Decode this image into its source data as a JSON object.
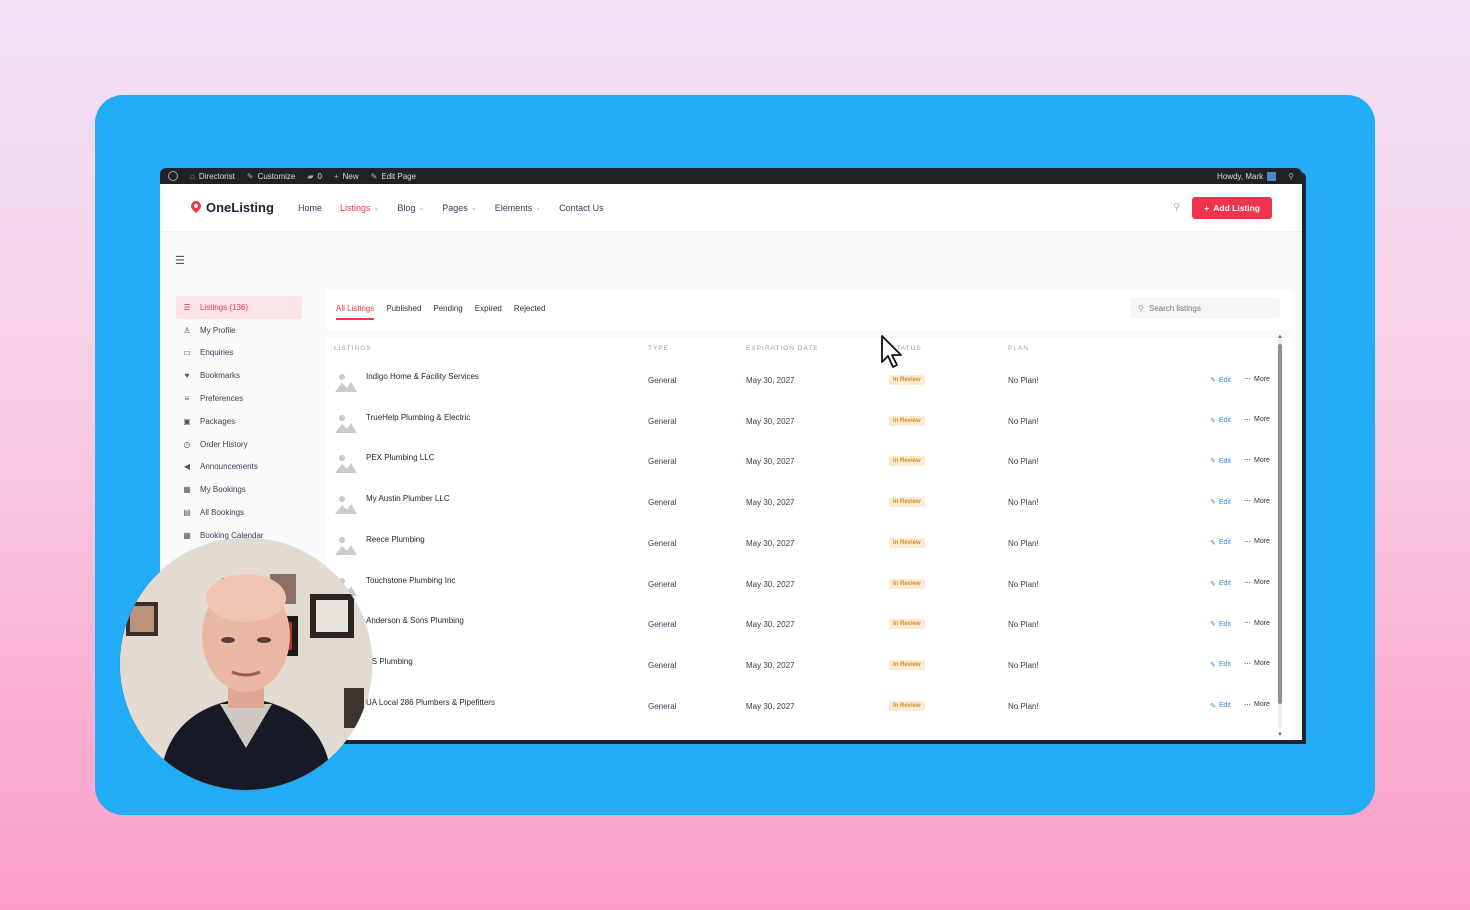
{
  "colors": {
    "accent": "#f0344c",
    "background_card": "#22adf6",
    "status_bg": "#fdecd2",
    "status_text": "#d3892b",
    "edit_link": "#3a8ed8"
  },
  "adminbar": {
    "site": "Directorist",
    "customize": "Customize",
    "comments": "0",
    "new": "New",
    "edit_page": "Edit Page",
    "howdy": "Howdy, Mark"
  },
  "header": {
    "logo": "OneListing",
    "nav": [
      "Home",
      "Listings",
      "Blog",
      "Pages",
      "Elements",
      "Contact Us"
    ],
    "add_listing": "Add Listing"
  },
  "sidebar": {
    "items": [
      {
        "label": "Listings (136)",
        "icon": "list-icon"
      },
      {
        "label": "My Profile",
        "icon": "user-icon"
      },
      {
        "label": "Enquiries",
        "icon": "inbox-icon"
      },
      {
        "label": "Bookmarks",
        "icon": "heart-icon"
      },
      {
        "label": "Preferences",
        "icon": "sliders-icon"
      },
      {
        "label": "Packages",
        "icon": "package-icon"
      },
      {
        "label": "Order History",
        "icon": "clock-icon"
      },
      {
        "label": "Announcements",
        "icon": "megaphone-icon"
      },
      {
        "label": "My Bookings",
        "icon": "calendar-icon"
      },
      {
        "label": "All Bookings",
        "icon": "table-icon"
      },
      {
        "label": "Booking Calendar",
        "icon": "calendar-icon"
      }
    ]
  },
  "tabs": [
    "All Listings",
    "Published",
    "Pending",
    "Expired",
    "Rejected"
  ],
  "search": {
    "placeholder": "Search listings"
  },
  "table": {
    "headers": [
      "LISTINGS",
      "TYPE",
      "EXPIRATION DATE",
      "STATUS",
      "PLAN"
    ],
    "edit_label": "Edit",
    "more_label": "More",
    "rows": [
      {
        "title": "Indigo Home & Facility Services",
        "type": "General",
        "expiration": "May 30, 2027",
        "status": "In Review",
        "plan": "No Plan!"
      },
      {
        "title": "TrueHelp Plumbing & Electric",
        "type": "General",
        "expiration": "May 30, 2027",
        "status": "In Review",
        "plan": "No Plan!"
      },
      {
        "title": "PEX Plumbing LLC",
        "type": "General",
        "expiration": "May 30, 2027",
        "status": "In Review",
        "plan": "No Plan!"
      },
      {
        "title": "My Austin Plumber LLC",
        "type": "General",
        "expiration": "May 30, 2027",
        "status": "In Review",
        "plan": "No Plan!"
      },
      {
        "title": "Reece Plumbing",
        "type": "General",
        "expiration": "May 30, 2027",
        "status": "In Review",
        "plan": "No Plan!"
      },
      {
        "title": "Touchstone Plumbing Inc",
        "type": "General",
        "expiration": "May 30, 2027",
        "status": "In Review",
        "plan": "No Plan!"
      },
      {
        "title": "Anderson & Sons Plumbing",
        "type": "General",
        "expiration": "May 30, 2027",
        "status": "In Review",
        "plan": "No Plan!"
      },
      {
        "title": "NS Plumbing",
        "type": "General",
        "expiration": "May 30, 2027",
        "status": "In Review",
        "plan": "No Plan!"
      },
      {
        "title": "UA Local 286 Plumbers & Pipefitters",
        "type": "General",
        "expiration": "May 30, 2027",
        "status": "In Review",
        "plan": "No Plan!"
      }
    ]
  }
}
